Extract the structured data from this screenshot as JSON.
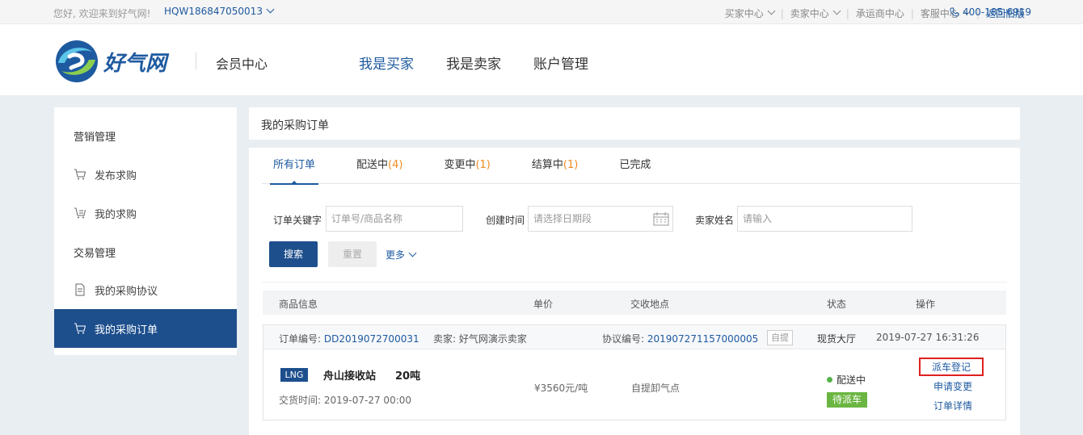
{
  "topbar": {
    "welcome": "您好, 欢迎来到好气网!",
    "account": "HQW186847050013",
    "nav": [
      "买家中心",
      "卖家中心",
      "承运商中心",
      "客服中心"
    ],
    "back_label": "返回旧版",
    "phone": "400-185-6919"
  },
  "header": {
    "logo_text": "好气网",
    "member_center": "会员中心",
    "nav": [
      "我是买家",
      "我是卖家",
      "账户管理"
    ]
  },
  "sidebar": {
    "marketing_heading": "营销管理",
    "publish_purchase": "发布求购",
    "my_purchase": "我的求购",
    "trade_heading": "交易管理",
    "my_agreement": "我的采购协议",
    "my_orders": "我的采购订单"
  },
  "page_title": "我的采购订单",
  "tabs": [
    {
      "label": "所有订单",
      "count": ""
    },
    {
      "label": "配送中",
      "count": "(4)"
    },
    {
      "label": "变更中",
      "count": "(1)"
    },
    {
      "label": "结算中",
      "count": "(1)"
    },
    {
      "label": "已完成",
      "count": ""
    }
  ],
  "filters": {
    "keyword_label": "订单关键字",
    "keyword_placeholder": "订单号/商品名称",
    "date_label": "创建时间",
    "date_placeholder": "请选择日期段",
    "seller_label": "卖家姓名",
    "seller_placeholder": "请输入",
    "search_button": "搜索",
    "reset_button": "重置",
    "more_label": "更多"
  },
  "table_headers": [
    "商品信息",
    "单价",
    "交收地点",
    "状态",
    "操作"
  ],
  "order": {
    "order_no_label": "订单编号:",
    "order_no": "DD2019072700031",
    "seller_label": "卖家:",
    "seller": "好气网演示卖家",
    "agreement_label": "协议编号:",
    "agreement_no": "201907271157000005",
    "pickup_tag": "自提",
    "hall": "现货大厅",
    "created": "2019-07-27 16:31:26",
    "product_tag": "LNG",
    "product_name": "舟山接收站",
    "quantity": "20吨",
    "delivery_time_label": "交货时间:",
    "delivery_time": "2019-07-27 00:00",
    "price": "¥3560元/吨",
    "location": "自提卸气点",
    "status": "配送中",
    "status_badge": "待派车",
    "actions": [
      "派车登记",
      "申请变更",
      "订单详情"
    ]
  },
  "colors": {
    "brand": "#1e4f8d",
    "link": "#1e5aa0",
    "count": "#f08c1e",
    "status_green": "#6bb642",
    "highlight_red": "#e02020"
  }
}
